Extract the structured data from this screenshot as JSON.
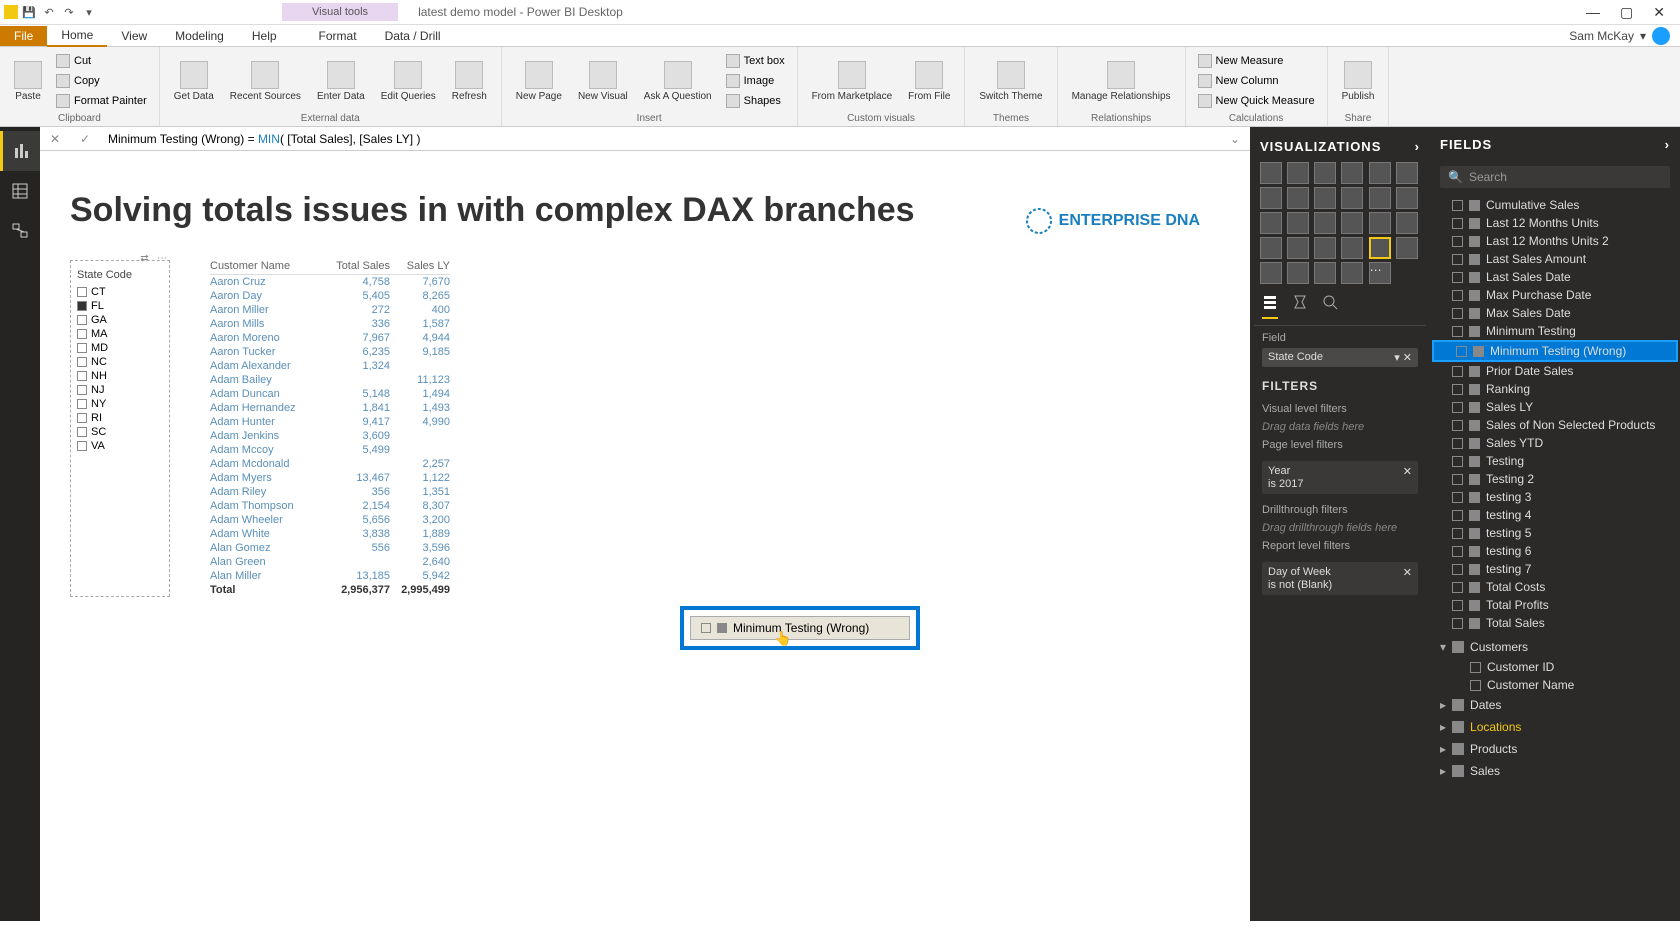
{
  "app": {
    "title": "latest demo model - Power BI Desktop",
    "visualtools": "Visual tools",
    "user": "Sam McKay"
  },
  "tabs": {
    "file": "File",
    "home": "Home",
    "view": "View",
    "modeling": "Modeling",
    "help": "Help",
    "format": "Format",
    "datadrill": "Data / Drill"
  },
  "ribbon": {
    "paste": "Paste",
    "cut": "Cut",
    "copy": "Copy",
    "formatpainter": "Format Painter",
    "clipboard": "Clipboard",
    "getdata": "Get Data",
    "recentsources": "Recent Sources",
    "enterdata": "Enter Data",
    "editqueries": "Edit Queries",
    "refresh": "Refresh",
    "externaldata": "External data",
    "newpage": "New Page",
    "newvisual": "New Visual",
    "askquestion": "Ask A Question",
    "textbox": "Text box",
    "image": "Image",
    "shapes": "Shapes",
    "insert": "Insert",
    "frommarketplace": "From Marketplace",
    "fromfile": "From File",
    "customvisuals": "Custom visuals",
    "switchtheme": "Switch Theme",
    "themes": "Themes",
    "managerelationships": "Manage Relationships",
    "relationships": "Relationships",
    "newmeasure": "New Measure",
    "newcolumn": "New Column",
    "newquickmeasure": "New Quick Measure",
    "calculations": "Calculations",
    "publish": "Publish",
    "share": "Share"
  },
  "formula": {
    "pre": "Minimum Testing (Wrong) = ",
    "fn": "MIN",
    "args": "( [Total Sales], [Sales LY] )"
  },
  "page": {
    "title": "Solving totals issues in with complex DAX branches",
    "logo": "ENTERPRISE DNA"
  },
  "slicer": {
    "header": "State Code",
    "items": [
      {
        "label": "CT",
        "checked": false
      },
      {
        "label": "FL",
        "checked": true
      },
      {
        "label": "GA",
        "checked": false
      },
      {
        "label": "MA",
        "checked": false
      },
      {
        "label": "MD",
        "checked": false
      },
      {
        "label": "NC",
        "checked": false
      },
      {
        "label": "NH",
        "checked": false
      },
      {
        "label": "NJ",
        "checked": false
      },
      {
        "label": "NY",
        "checked": false
      },
      {
        "label": "RI",
        "checked": false
      },
      {
        "label": "SC",
        "checked": false
      },
      {
        "label": "VA",
        "checked": false
      }
    ]
  },
  "table": {
    "headers": {
      "c1": "Customer Name",
      "c2": "Total Sales",
      "c3": "Sales LY"
    },
    "rows": [
      {
        "c1": "Aaron Cruz",
        "c2": "4,758",
        "c3": "7,670"
      },
      {
        "c1": "Aaron Day",
        "c2": "5,405",
        "c3": "8,265"
      },
      {
        "c1": "Aaron Miller",
        "c2": "272",
        "c3": "400"
      },
      {
        "c1": "Aaron Mills",
        "c2": "336",
        "c3": "1,587"
      },
      {
        "c1": "Aaron Moreno",
        "c2": "7,967",
        "c3": "4,944"
      },
      {
        "c1": "Aaron Tucker",
        "c2": "6,235",
        "c3": "9,185"
      },
      {
        "c1": "Adam Alexander",
        "c2": "1,324",
        "c3": ""
      },
      {
        "c1": "Adam Bailey",
        "c2": "",
        "c3": "11,123"
      },
      {
        "c1": "Adam Duncan",
        "c2": "5,148",
        "c3": "1,494"
      },
      {
        "c1": "Adam Hernandez",
        "c2": "1,841",
        "c3": "1,493"
      },
      {
        "c1": "Adam Hunter",
        "c2": "9,417",
        "c3": "4,990"
      },
      {
        "c1": "Adam Jenkins",
        "c2": "3,609",
        "c3": ""
      },
      {
        "c1": "Adam Mccoy",
        "c2": "5,499",
        "c3": ""
      },
      {
        "c1": "Adam Mcdonald",
        "c2": "",
        "c3": "2,257"
      },
      {
        "c1": "Adam Myers",
        "c2": "13,467",
        "c3": "1,122"
      },
      {
        "c1": "Adam Riley",
        "c2": "356",
        "c3": "1,351"
      },
      {
        "c1": "Adam Thompson",
        "c2": "2,154",
        "c3": "8,307"
      },
      {
        "c1": "Adam Wheeler",
        "c2": "5,656",
        "c3": "3,200"
      },
      {
        "c1": "Adam White",
        "c2": "3,838",
        "c3": "1,889"
      },
      {
        "c1": "Alan Gomez",
        "c2": "556",
        "c3": "3,596"
      },
      {
        "c1": "Alan Green",
        "c2": "",
        "c3": "2,640"
      },
      {
        "c1": "Alan Miller",
        "c2": "13,185",
        "c3": "5,942"
      }
    ],
    "total": {
      "c1": "Total",
      "c2": "2,956,377",
      "c3": "2,995,499"
    }
  },
  "dragchip": "Minimum Testing (Wrong)",
  "viz": {
    "header": "VISUALIZATIONS",
    "fieldLabel": "Field",
    "fieldValue": "State Code",
    "filtersHeader": "FILTERS",
    "vlf": "Visual level filters",
    "dropHere": "Drag data fields here",
    "plf": "Page level filters",
    "yearName": "Year",
    "yearVal": "is 2017",
    "dtf": "Drillthrough filters",
    "dtfDrop": "Drag drillthrough fields here",
    "rlf": "Report level filters",
    "dowName": "Day of Week",
    "dowVal": "is not (Blank)"
  },
  "fields": {
    "header": "FIELDS",
    "search": "Search",
    "measures": [
      "Cumulative Sales",
      "Last 12 Months Units",
      "Last 12 Months Units 2",
      "Last Sales Amount",
      "Last Sales Date",
      "Max Purchase Date",
      "Max Sales Date",
      "Minimum Testing",
      "Minimum Testing (Wrong)",
      "Prior Date Sales",
      "Ranking",
      "Sales LY",
      "Sales of Non Selected Products",
      "Sales YTD",
      "Testing",
      "Testing 2",
      "testing 3",
      "testing 4",
      "testing 5",
      "testing 6",
      "testing 7",
      "Total Costs",
      "Total Profits",
      "Total Sales"
    ],
    "highlightIndex": 8,
    "tables": [
      {
        "name": "Customers",
        "expanded": true,
        "cols": [
          "Customer ID",
          "Customer Name"
        ]
      },
      {
        "name": "Dates",
        "expanded": false
      },
      {
        "name": "Locations",
        "expanded": false,
        "highlight": true
      },
      {
        "name": "Products",
        "expanded": false
      },
      {
        "name": "Sales",
        "expanded": false
      }
    ]
  }
}
